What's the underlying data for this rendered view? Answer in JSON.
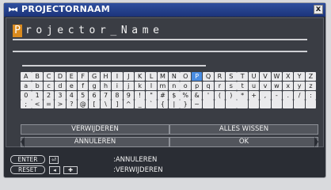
{
  "window": {
    "title": "PROJECTORNAAM",
    "close_label": "x"
  },
  "name_input": {
    "cursor_char": "P",
    "value": "rojector_Name"
  },
  "keyboard": {
    "selected_key": "P",
    "rows": [
      [
        "A",
        "B",
        "C",
        "D",
        "E",
        "F",
        "G",
        "H",
        "I",
        "J",
        "K",
        "L",
        "M",
        "N",
        "O",
        "P",
        "Q",
        "R",
        "S",
        "T",
        "U",
        "V",
        "W",
        "X",
        "Y",
        "Z"
      ],
      [
        "a",
        "b",
        "c",
        "d",
        "e",
        "f",
        "g",
        "h",
        "i",
        "j",
        "k",
        "l",
        "m",
        "n",
        "o",
        "p",
        "q",
        "r",
        "s",
        "t",
        "u",
        "v",
        "w",
        "x",
        "y",
        "z"
      ],
      [
        "0",
        "1",
        "2",
        "3",
        "4",
        "5",
        "6",
        "7",
        "8",
        "9",
        "!",
        "\"",
        "#",
        "$",
        "%",
        "&",
        "'",
        "(",
        ")",
        "*",
        "+",
        ",",
        "-",
        ".",
        "/",
        ":"
      ],
      [
        ";",
        "<",
        "=",
        ">",
        "?",
        "@",
        "[",
        "\\",
        "]",
        "^",
        "_",
        "`",
        "{",
        "|",
        "}",
        "~",
        " ",
        " ",
        " ",
        " ",
        " ",
        " ",
        " ",
        " ",
        " ",
        " "
      ]
    ]
  },
  "actions": {
    "delete": "VERWIJDEREN",
    "clear_all": "ALLES WISSEN",
    "cancel": "ANNULEREN",
    "ok": "OK"
  },
  "help": {
    "enter_label": "ENTER",
    "reset_label": "RESET",
    "enter_desc": ":ANNULEREN",
    "reset_desc": ":VERWIJDEREN"
  },
  "colors": {
    "title_bar": "#1c347a",
    "selected_key": "#4a8de2",
    "cursor": "#d98a1e"
  }
}
